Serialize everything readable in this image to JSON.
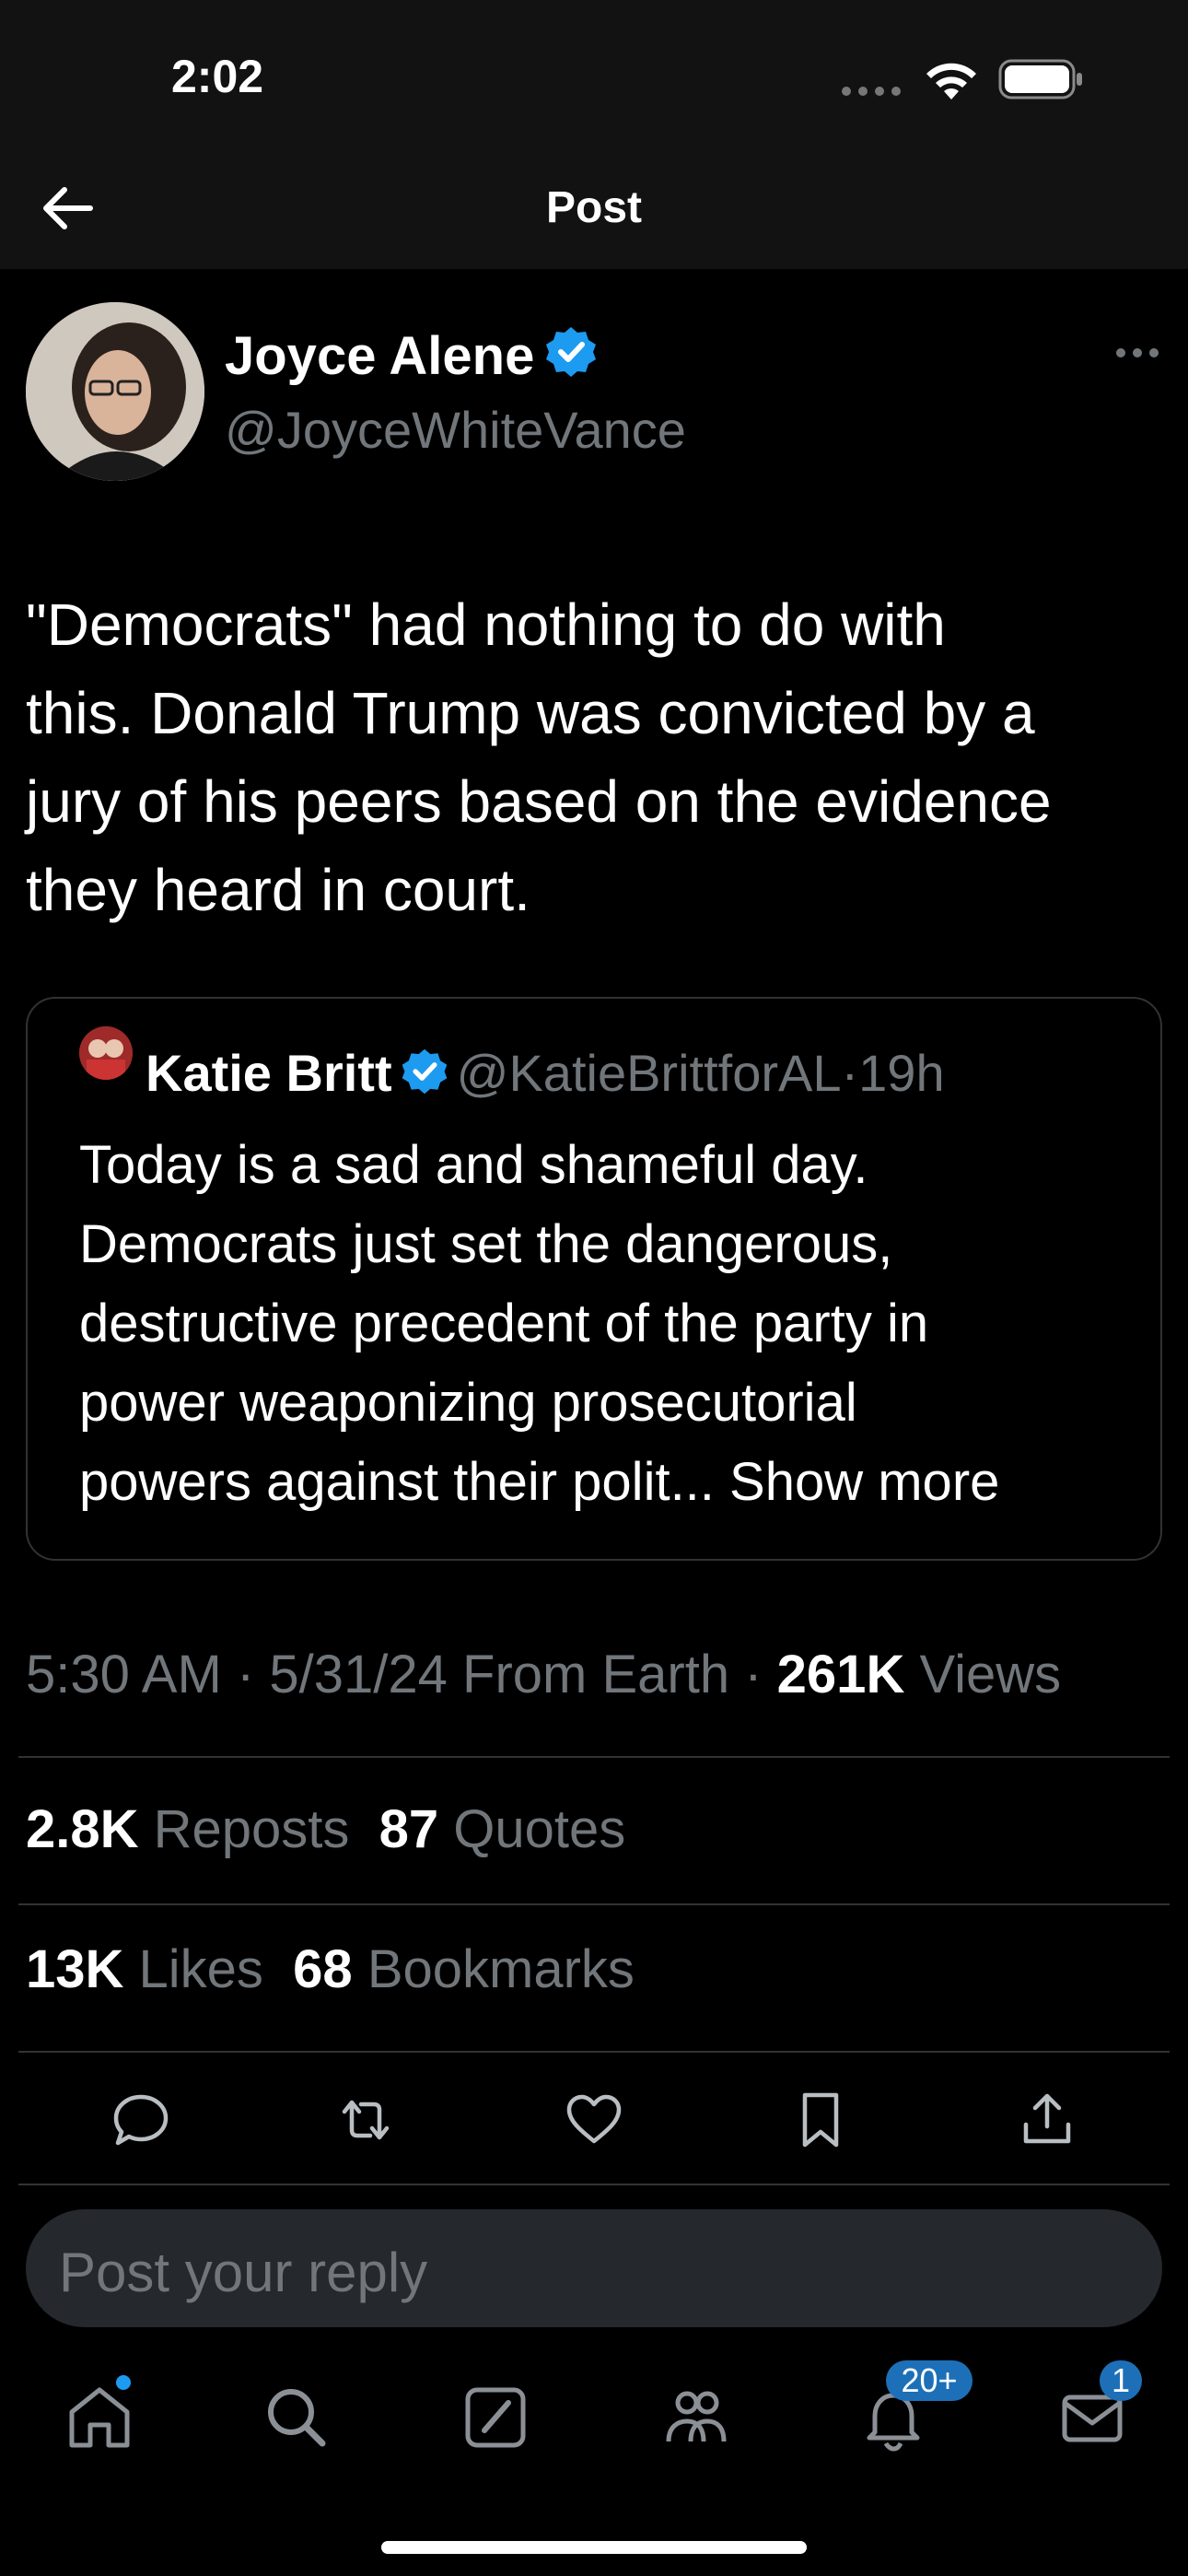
{
  "status_bar": {
    "time": "2:02"
  },
  "nav": {
    "title": "Post"
  },
  "post": {
    "author_name": "Joyce Alene",
    "author_handle": "@JoyceWhiteVance",
    "text_lines": [
      "\"Democrats\" had nothing to do with",
      "this. Donald Trump was convicted by a",
      "jury of his peers based on the evidence",
      "they heard in court."
    ]
  },
  "quote": {
    "name": "Katie Britt",
    "handle": "@KatieBrittforAL",
    "separator": "·",
    "time": "19h",
    "text_lines": [
      "Today is a sad and shameful day.",
      "Democrats just set the dangerous,",
      "destructive precedent of the party in",
      "power weaponizing prosecutorial"
    ],
    "last_line": "powers against their polit...",
    "show_more": "Show more"
  },
  "meta": {
    "time": "5:30 AM",
    "date": "5/31/24",
    "source": "From Earth",
    "sep": "·",
    "views_count": "261K",
    "views_label": "Views"
  },
  "stats": {
    "reposts_count": "2.8K",
    "reposts_label": "Reposts",
    "quotes_count": "87",
    "quotes_label": "Quotes",
    "likes_count": "13K",
    "likes_label": "Likes",
    "bookmarks_count": "68",
    "bookmarks_label": "Bookmarks"
  },
  "reply": {
    "placeholder": "Post your reply"
  },
  "tabbar": {
    "notifications_badge": "20+",
    "messages_badge": "1"
  },
  "colors": {
    "background": "#000000",
    "header_background": "#121212",
    "verified": "#1d9bf0",
    "muted_text": "#71767b",
    "badge": "#1d70b8"
  }
}
